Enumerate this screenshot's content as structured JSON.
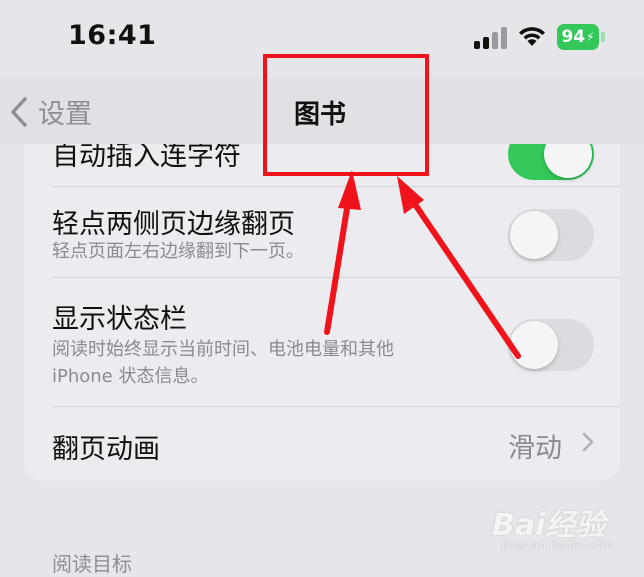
{
  "status": {
    "time": "16:41",
    "battery": "94",
    "signal_icon": "cellular-signal-icon",
    "wifi_icon": "wifi-icon"
  },
  "nav": {
    "back_label": "设置",
    "title": "图书"
  },
  "settings": {
    "partial_label": "自动插入连字符",
    "rows": [
      {
        "title": "轻点两侧页边缘翻页",
        "subtitle": "轻点页面左右边缘翻到下一页。",
        "toggle": "off"
      },
      {
        "title": "显示状态栏",
        "subtitle_line1": "阅读时始终显示当前时间、电池电量和其他",
        "subtitle_line2": "iPhone 状态信息。",
        "toggle": "off"
      },
      {
        "title": "翻页动画",
        "value": "滑动"
      }
    ]
  },
  "section_header": "阅读目标",
  "watermark": {
    "brand": "Bai经验",
    "sub": "jingyan.baidu.com"
  },
  "colors": {
    "toggle_on": "#34c759",
    "annotation": "#f0131b"
  }
}
